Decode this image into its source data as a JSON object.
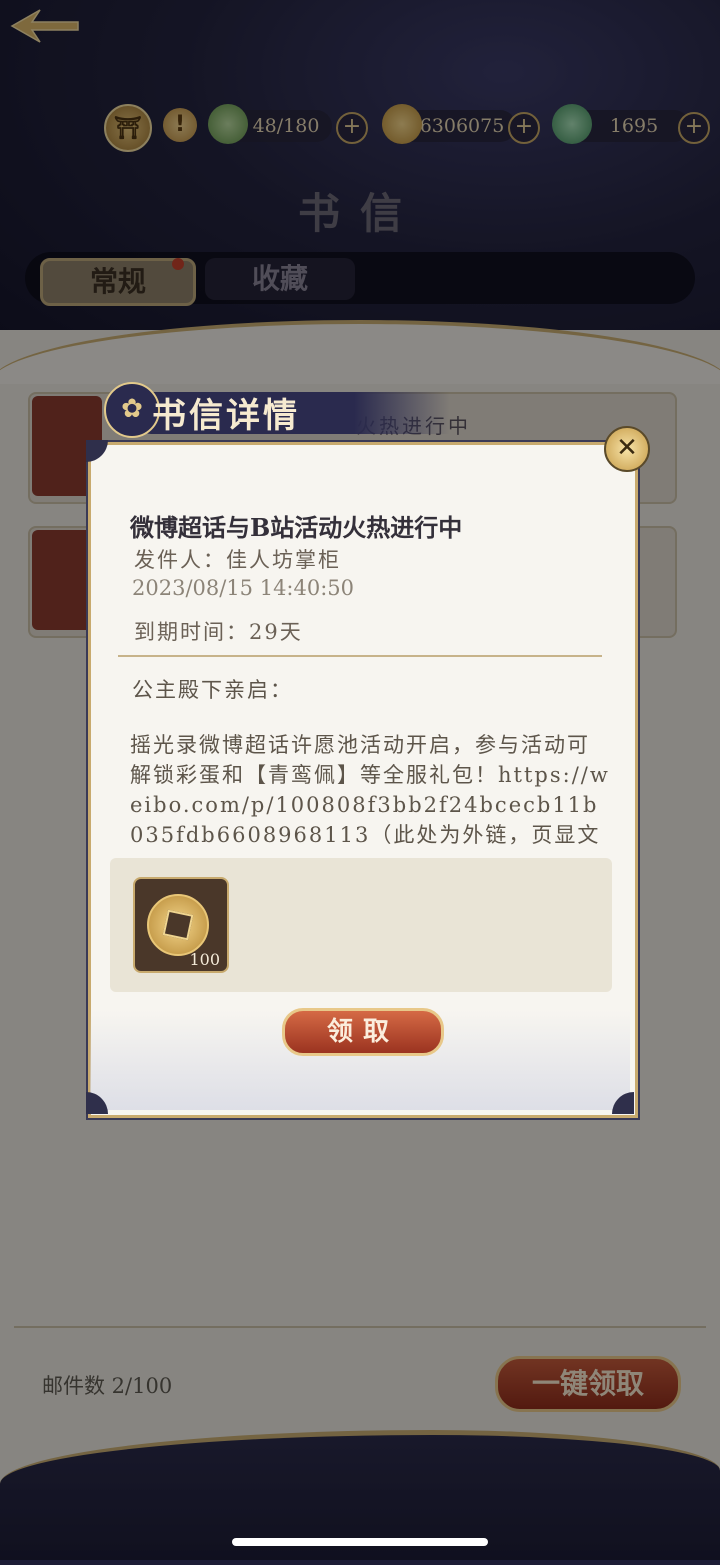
{
  "header": {
    "title": "书信",
    "resources": [
      {
        "name": "stamina",
        "value": "48/180",
        "icon": "leaf-icon"
      },
      {
        "name": "coins",
        "value": "6306075",
        "icon": "coin-icon"
      },
      {
        "name": "jade",
        "value": "1695",
        "icon": "jade-icon"
      }
    ]
  },
  "tabs": [
    {
      "label": "常规",
      "active": true,
      "badge": true
    },
    {
      "label": "收藏",
      "active": false
    }
  ],
  "list": {
    "item_tail_text": "火热进行中"
  },
  "dialog": {
    "header_title": "书信详情",
    "mail_title": "微博超话与B站活动火热进行中",
    "sender": "发件人：佳人坊掌柜",
    "datetime": "2023/08/15 14:40:50",
    "expire": "到期时间：29天",
    "greeting": "公主殿下亲启：",
    "body": "摇光录微博超话许愿池活动开启，参与活动可解锁彩蛋和【青鸾佩】等全服礼包！https://weibo.com/p/100808f3bb2f24bcecb11b035fdb6608968113（此处为外链，页显文",
    "reward": {
      "icon": "copper-coin-icon",
      "count": "100"
    },
    "claim_label": "领取"
  },
  "footer": {
    "mail_count": "邮件数 2/100",
    "claim_all_label": "一键领取"
  },
  "colors": {
    "accent_gold": "#c8aa6e",
    "button_red": "#b5452c",
    "dark_bg": "#1b1a33"
  }
}
